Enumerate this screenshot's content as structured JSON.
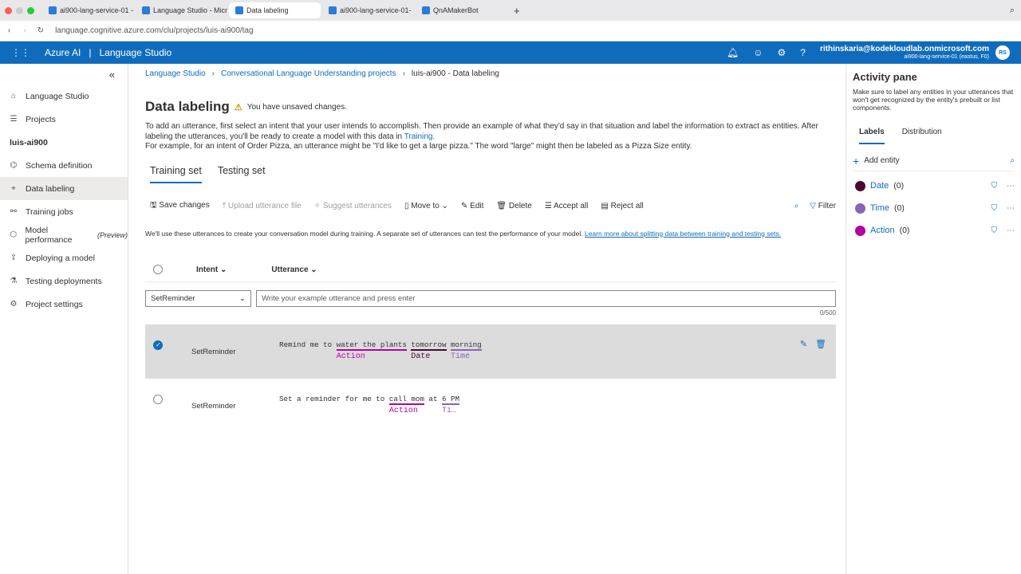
{
  "browser": {
    "tabs": [
      {
        "title": "ai900-lang-service-01 -"
      },
      {
        "title": "Language Studio - Micro"
      },
      {
        "title": "Data labeling",
        "active": true
      },
      {
        "title": "ai900-lang-service-01-"
      },
      {
        "title": "QnAMakerBot"
      }
    ],
    "url": "language.cognitive.azure.com/clu/projects/luis-ai900/tag"
  },
  "appbar": {
    "brand": "Azure AI",
    "sep": "|",
    "product": "Language Studio",
    "user_email": "rithinskaria@kodekloudlab.onmicrosoft.com",
    "resource": "ai900-lang-service-01 (eastus, F0)",
    "initials": "RS"
  },
  "sidebar": {
    "items": [
      {
        "label": "Language Studio",
        "icon": "home-icon"
      },
      {
        "label": "Projects",
        "icon": "list-icon"
      },
      {
        "label": "luis-ai900",
        "header": true
      },
      {
        "label": "Schema definition",
        "icon": "schema-icon"
      },
      {
        "label": "Data labeling",
        "icon": "tag-icon",
        "active": true
      },
      {
        "label": "Training jobs",
        "icon": "training-icon"
      },
      {
        "label": "Model performance",
        "suffix": "(Preview)",
        "icon": "chart-icon"
      },
      {
        "label": "Deploying a model",
        "icon": "deploy-icon"
      },
      {
        "label": "Testing deployments",
        "icon": "flask-icon"
      },
      {
        "label": "Project settings",
        "icon": "gear-icon"
      }
    ]
  },
  "breadcrumb": [
    "Language Studio",
    "Conversational Language Understanding projects",
    "luis-ai900 - Data labeling"
  ],
  "page": {
    "title": "Data labeling",
    "warning": "You have unsaved changes.",
    "desc1": "To add an utterance, first select an intent that your user intends to accomplish. Then provide an example of what they'd say in that situation and label the information to extract as entities. After labeling the utterances, you'll be ready to create a model with this data in ",
    "desc1_link": "Training.",
    "desc2": "For example, for an intent of Order Pizza, an utterance might be \"I'd like to get a large pizza.\" The word \"large\" might then be labeled as a Pizza Size entity.",
    "tabs": [
      "Training set",
      "Testing set"
    ],
    "toolbar": {
      "save": "Save changes",
      "upload": "Upload utterance file",
      "suggest": "Suggest utterances",
      "move": "Move to",
      "edit": "Edit",
      "delete": "Delete",
      "accept": "Accept all",
      "reject": "Reject all",
      "filter": "Filter"
    },
    "note": "We'll use these utterances to create your conversation model during training. A separate set of utterances can test the performance of your model. ",
    "note_link": "Learn more about splitting data between training and testing sets.",
    "columns": {
      "intent": "Intent",
      "utterance": "Utterance"
    },
    "intent_select": "SetReminder",
    "utterance_placeholder": "Write your example utterance and press enter",
    "char_count": "0/500",
    "rows": [
      {
        "intent": "SetReminder",
        "selected": true,
        "segments": [
          {
            "text": "Remind me to "
          },
          {
            "text": "water the plants",
            "entity": "Action",
            "color": "#b4009e"
          },
          {
            "text": " "
          },
          {
            "text": "tomorrow",
            "entity": "Date",
            "color": "#4a0a2f"
          },
          {
            "text": " "
          },
          {
            "text": "morning",
            "entity": "Time",
            "color": "#8764b8"
          }
        ]
      },
      {
        "intent": "SetReminder",
        "selected": false,
        "segments": [
          {
            "text": "Set a reminder for me to "
          },
          {
            "text": "call mom",
            "entity": "Action",
            "color": "#b4009e"
          },
          {
            "text": " at "
          },
          {
            "text": "6 PM",
            "entity": "Ti…",
            "color": "#8764b8"
          }
        ]
      }
    ]
  },
  "pane": {
    "title": "Activity pane",
    "desc": "Make sure to label any entities in your utterances that won't get recognized by the entity's prebuilt or list components.",
    "tabs": [
      "Labels",
      "Distribution"
    ],
    "add": "Add entity",
    "entities": [
      {
        "name": "Date",
        "count": "(0)",
        "color": "#4a0a2f"
      },
      {
        "name": "Time",
        "count": "(0)",
        "color": "#8764b8"
      },
      {
        "name": "Action",
        "count": "(0)",
        "color": "#b4009e"
      }
    ]
  }
}
